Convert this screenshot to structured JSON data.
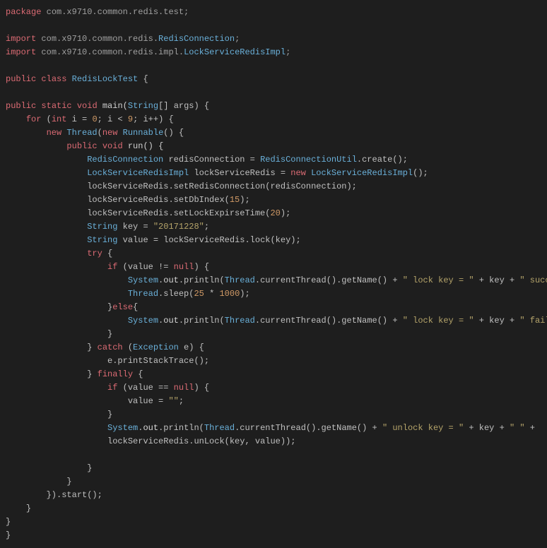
{
  "l1_kw": "package",
  "l1_pkg": " com.x9710.common.redis.test;",
  "l3_kw": "import",
  "l3_pkg": " com.x9710.common.redis.",
  "l3_cls": "RedisConnection",
  "l3_end": ";",
  "l4_kw": "import",
  "l4_pkg": " com.x9710.common.redis.impl.",
  "l4_cls": "LockServiceRedisImpl",
  "l4_end": ";",
  "l6_kw1": "public",
  "l6_kw2": "class",
  "l6_cls": "RedisLockTest",
  "l6_br": " {",
  "l8_kw1": "public",
  "l8_kw2": "static",
  "l8_kw3": "void",
  "l8_name": " main(",
  "l8_type": "String",
  "l8_rest": "[] args) {",
  "l9_kw": "for",
  "l9_a": " (",
  "l9_int": "int",
  "l9_b": " i = ",
  "l9_n0": "0",
  "l9_c": "; i < ",
  "l9_n9": "9",
  "l9_d": "; i++) {",
  "l10_kw1": "new",
  "l10_cls": "Thread",
  "l10_a": "(",
  "l10_kw2": "new",
  "l10_cls2": "Runnable",
  "l10_b": "() {",
  "l11_kw1": "public",
  "l11_kw2": "void",
  "l11_name": " run() {",
  "l12_cls": "RedisConnection",
  "l12_var": " redisConnection = ",
  "l12_cls2": "RedisConnectionUtil",
  "l12_rest": ".create();",
  "l13_cls": "LockServiceRedisImpl",
  "l13_var": " lockServiceRedis = ",
  "l13_kw": "new",
  "l13_cls2": "LockServiceRedisImpl",
  "l13_rest": "();",
  "l14": "lockServiceRedis.setRedisConnection(redisConnection);",
  "l15_a": "lockServiceRedis.setDbIndex(",
  "l15_n": "15",
  "l15_b": ");",
  "l16_a": "lockServiceRedis.setLockExpirseTime(",
  "l16_n": "20",
  "l16_b": ");",
  "l17_cls": "String",
  "l17_a": " key = ",
  "l17_str": "\"20171228\"",
  "l17_b": ";",
  "l18_cls": "String",
  "l18_a": " value = lockServiceRedis.lock(key);",
  "l19_kw": "try",
  "l19_b": " {",
  "l20_kw": "if",
  "l20_a": " (value != ",
  "l20_null": "null",
  "l20_b": ") {",
  "l21_cls": "System",
  "l21_a": ".",
  "l21_out": "out",
  "l21_b": ".println(",
  "l21_cls2": "Thread",
  "l21_c": ".currentThread().getName() + ",
  "l21_str": "\" lock key = \"",
  "l21_d": " + key + ",
  "l21_str2": "\" success! \"",
  "l21_e": ");",
  "l22_cls": "Thread",
  "l22_a": ".sleep(",
  "l22_n1": "25",
  "l22_b": " * ",
  "l22_n2": "1000",
  "l22_c": ");",
  "l23_a": "}",
  "l23_kw": "else",
  "l23_b": "{",
  "l24_cls": "System",
  "l24_a": ".",
  "l24_out": "out",
  "l24_b": ".println(",
  "l24_cls2": "Thread",
  "l24_c": ".currentThread().getName() + ",
  "l24_str": "\" lock key = \"",
  "l24_d": " + key + ",
  "l24_str2": "\" failure! \"",
  "l24_e": ");",
  "l25": "}",
  "l26_a": "} ",
  "l26_kw": "catch",
  "l26_b": " (",
  "l26_cls": "Exception",
  "l26_c": " e) {",
  "l27": "e.printStackTrace();",
  "l28_a": "} ",
  "l28_kw": "finally",
  "l28_b": " {",
  "l29_kw": "if",
  "l29_a": " (value == ",
  "l29_null": "null",
  "l29_b": ") {",
  "l30_a": "value = ",
  "l30_str": "\"\"",
  "l30_b": ";",
  "l31": "}",
  "l32_cls": "System",
  "l32_a": ".",
  "l32_out": "out",
  "l32_b": ".println(",
  "l32_cls2": "Thread",
  "l32_c": ".currentThread().getName() + ",
  "l32_str": "\" unlock key = \"",
  "l32_d": " + key + ",
  "l32_str2": "\" \"",
  "l32_e": " + ",
  "l33": "lockServiceRedis.unLock(key, value));",
  "l35": "}",
  "l36": "}",
  "l37": "}).start();",
  "l38": "}",
  "l39": "}",
  "l40": "}"
}
